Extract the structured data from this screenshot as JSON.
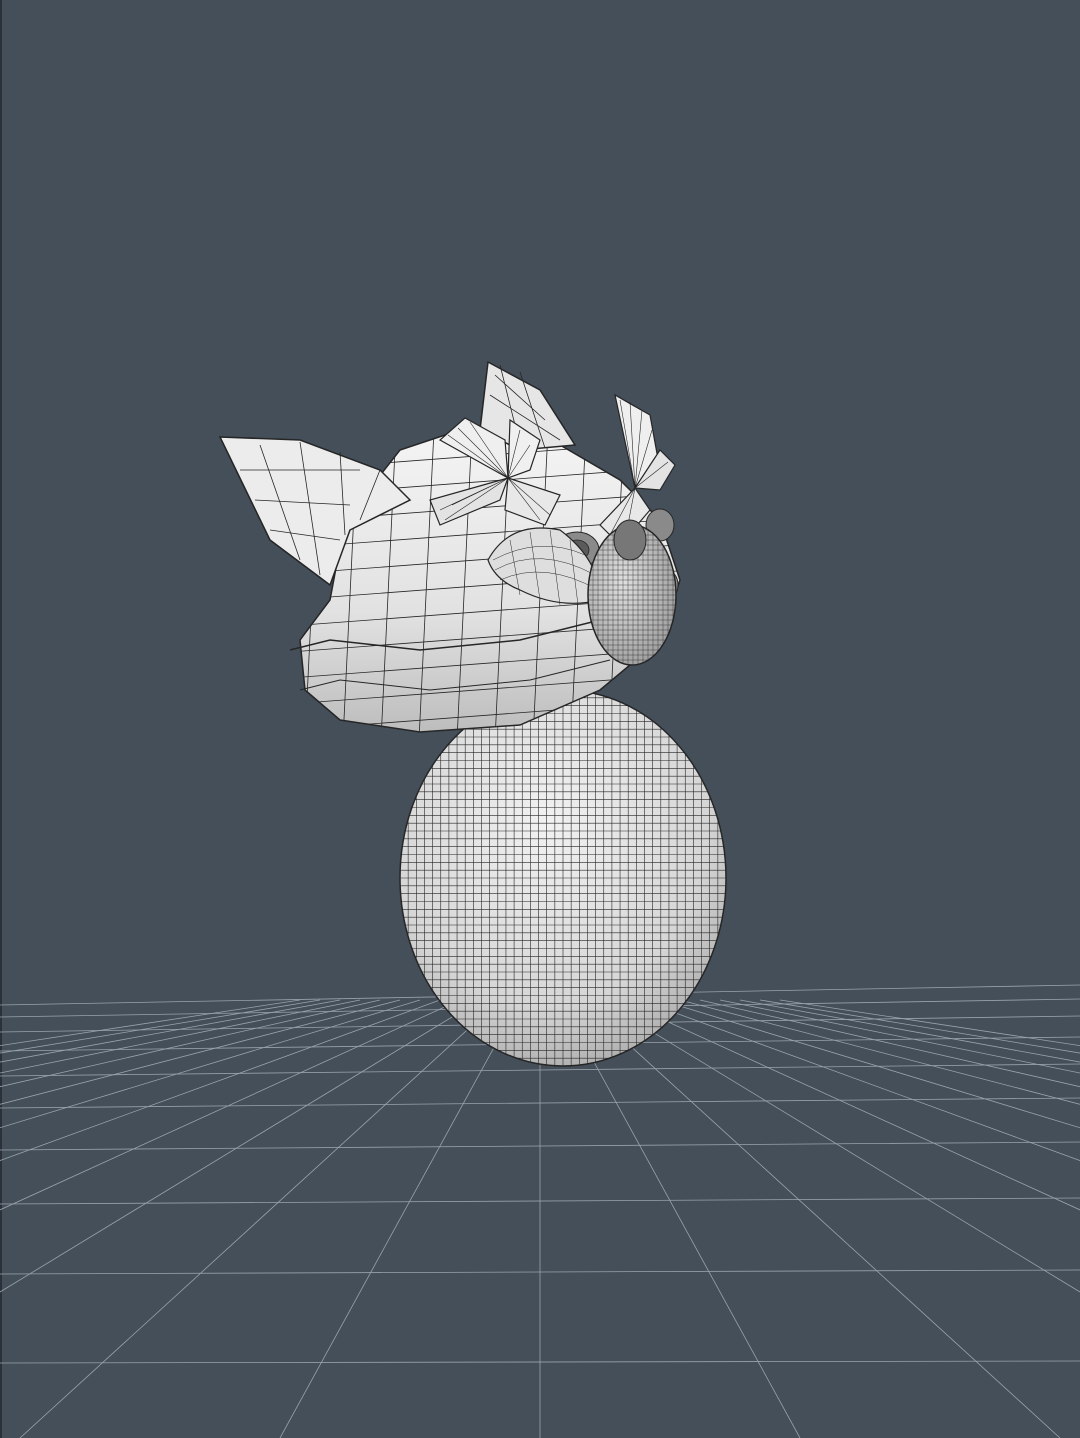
{
  "viewport": {
    "background_color": "#444f5a",
    "grid_color": "#9aa3ab",
    "mesh_fill": "#e9e9e9",
    "mesh_shadow": "#b9b9b9",
    "wire_color": "#262626",
    "grid_visible": true,
    "shading": "wireframe-on-shaded",
    "view": "perspective"
  },
  "model": {
    "parts": [
      "body-sphere",
      "head",
      "left-ear",
      "right-ear",
      "bow-left",
      "bow-right",
      "snout",
      "eyes"
    ]
  }
}
